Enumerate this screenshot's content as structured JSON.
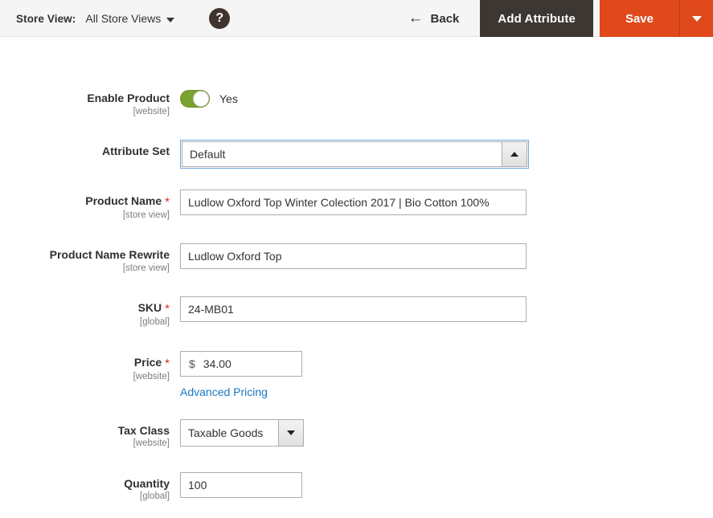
{
  "header": {
    "store_view_label": "Store View:",
    "store_view_value": "All Store Views",
    "help_icon_glyph": "?",
    "back_label": "Back",
    "back_arrow_glyph": "←",
    "add_attribute_label": "Add Attribute",
    "save_label": "Save",
    "colors": {
      "bar_background": "#f5f5f5",
      "add_attribute_background": "#3c3732",
      "save_background": "#e0491b",
      "help_background": "#41362f"
    }
  },
  "form": {
    "fields": [
      {
        "label": "Enable Product",
        "scope": "[website]",
        "required": false,
        "type": "toggle",
        "value": "Yes",
        "toggle_on": true
      },
      {
        "label": "Attribute Set",
        "scope": "",
        "required": false,
        "type": "select",
        "value": "Default",
        "arrow": "up",
        "focused": true
      },
      {
        "label": "Product Name",
        "scope": "[store view]",
        "required": true,
        "type": "text",
        "value": "Ludlow Oxford Top Winter Colection 2017 | Bio Cotton 100%",
        "placeholder": ""
      },
      {
        "label": "Product Name Rewrite",
        "scope": "[store view]",
        "required": false,
        "type": "text",
        "value": "Ludlow Oxford Top",
        "placeholder": ""
      },
      {
        "label": "SKU",
        "scope": "[global]",
        "required": true,
        "type": "text",
        "value": "24-MB01",
        "placeholder": ""
      },
      {
        "label": "Price",
        "scope": "[website]",
        "required": true,
        "type": "currency",
        "currency_symbol": "$",
        "value": "34.00",
        "placeholder": "",
        "sub_link": "Advanced Pricing"
      },
      {
        "label": "Tax Class",
        "scope": "[website]",
        "required": false,
        "type": "select",
        "value": "Taxable Goods",
        "arrow": "down",
        "focused": false
      },
      {
        "label": "Quantity",
        "scope": "[global]",
        "required": false,
        "type": "text",
        "value": "100",
        "placeholder": ""
      }
    ]
  }
}
